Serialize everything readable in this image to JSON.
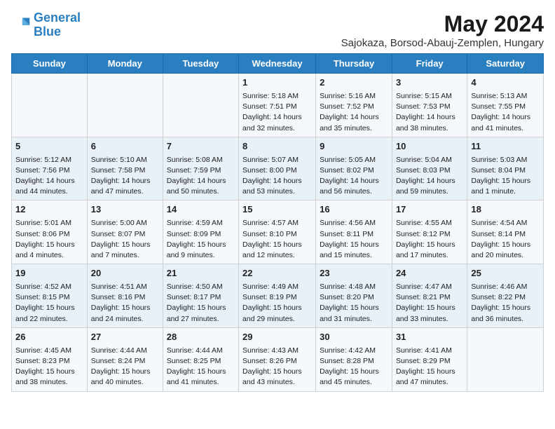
{
  "logo": {
    "line1": "General",
    "line2": "Blue"
  },
  "title": "May 2024",
  "subtitle": "Sajokaza, Borsod-Abauj-Zemplen, Hungary",
  "days_of_week": [
    "Sunday",
    "Monday",
    "Tuesday",
    "Wednesday",
    "Thursday",
    "Friday",
    "Saturday"
  ],
  "weeks": [
    [
      {
        "day": "",
        "info": ""
      },
      {
        "day": "",
        "info": ""
      },
      {
        "day": "",
        "info": ""
      },
      {
        "day": "1",
        "info": "Sunrise: 5:18 AM\nSunset: 7:51 PM\nDaylight: 14 hours and 32 minutes."
      },
      {
        "day": "2",
        "info": "Sunrise: 5:16 AM\nSunset: 7:52 PM\nDaylight: 14 hours and 35 minutes."
      },
      {
        "day": "3",
        "info": "Sunrise: 5:15 AM\nSunset: 7:53 PM\nDaylight: 14 hours and 38 minutes."
      },
      {
        "day": "4",
        "info": "Sunrise: 5:13 AM\nSunset: 7:55 PM\nDaylight: 14 hours and 41 minutes."
      }
    ],
    [
      {
        "day": "5",
        "info": "Sunrise: 5:12 AM\nSunset: 7:56 PM\nDaylight: 14 hours and 44 minutes."
      },
      {
        "day": "6",
        "info": "Sunrise: 5:10 AM\nSunset: 7:58 PM\nDaylight: 14 hours and 47 minutes."
      },
      {
        "day": "7",
        "info": "Sunrise: 5:08 AM\nSunset: 7:59 PM\nDaylight: 14 hours and 50 minutes."
      },
      {
        "day": "8",
        "info": "Sunrise: 5:07 AM\nSunset: 8:00 PM\nDaylight: 14 hours and 53 minutes."
      },
      {
        "day": "9",
        "info": "Sunrise: 5:05 AM\nSunset: 8:02 PM\nDaylight: 14 hours and 56 minutes."
      },
      {
        "day": "10",
        "info": "Sunrise: 5:04 AM\nSunset: 8:03 PM\nDaylight: 14 hours and 59 minutes."
      },
      {
        "day": "11",
        "info": "Sunrise: 5:03 AM\nSunset: 8:04 PM\nDaylight: 15 hours and 1 minute."
      }
    ],
    [
      {
        "day": "12",
        "info": "Sunrise: 5:01 AM\nSunset: 8:06 PM\nDaylight: 15 hours and 4 minutes."
      },
      {
        "day": "13",
        "info": "Sunrise: 5:00 AM\nSunset: 8:07 PM\nDaylight: 15 hours and 7 minutes."
      },
      {
        "day": "14",
        "info": "Sunrise: 4:59 AM\nSunset: 8:09 PM\nDaylight: 15 hours and 9 minutes."
      },
      {
        "day": "15",
        "info": "Sunrise: 4:57 AM\nSunset: 8:10 PM\nDaylight: 15 hours and 12 minutes."
      },
      {
        "day": "16",
        "info": "Sunrise: 4:56 AM\nSunset: 8:11 PM\nDaylight: 15 hours and 15 minutes."
      },
      {
        "day": "17",
        "info": "Sunrise: 4:55 AM\nSunset: 8:12 PM\nDaylight: 15 hours and 17 minutes."
      },
      {
        "day": "18",
        "info": "Sunrise: 4:54 AM\nSunset: 8:14 PM\nDaylight: 15 hours and 20 minutes."
      }
    ],
    [
      {
        "day": "19",
        "info": "Sunrise: 4:52 AM\nSunset: 8:15 PM\nDaylight: 15 hours and 22 minutes."
      },
      {
        "day": "20",
        "info": "Sunrise: 4:51 AM\nSunset: 8:16 PM\nDaylight: 15 hours and 24 minutes."
      },
      {
        "day": "21",
        "info": "Sunrise: 4:50 AM\nSunset: 8:17 PM\nDaylight: 15 hours and 27 minutes."
      },
      {
        "day": "22",
        "info": "Sunrise: 4:49 AM\nSunset: 8:19 PM\nDaylight: 15 hours and 29 minutes."
      },
      {
        "day": "23",
        "info": "Sunrise: 4:48 AM\nSunset: 8:20 PM\nDaylight: 15 hours and 31 minutes."
      },
      {
        "day": "24",
        "info": "Sunrise: 4:47 AM\nSunset: 8:21 PM\nDaylight: 15 hours and 33 minutes."
      },
      {
        "day": "25",
        "info": "Sunrise: 4:46 AM\nSunset: 8:22 PM\nDaylight: 15 hours and 36 minutes."
      }
    ],
    [
      {
        "day": "26",
        "info": "Sunrise: 4:45 AM\nSunset: 8:23 PM\nDaylight: 15 hours and 38 minutes."
      },
      {
        "day": "27",
        "info": "Sunrise: 4:44 AM\nSunset: 8:24 PM\nDaylight: 15 hours and 40 minutes."
      },
      {
        "day": "28",
        "info": "Sunrise: 4:44 AM\nSunset: 8:25 PM\nDaylight: 15 hours and 41 minutes."
      },
      {
        "day": "29",
        "info": "Sunrise: 4:43 AM\nSunset: 8:26 PM\nDaylight: 15 hours and 43 minutes."
      },
      {
        "day": "30",
        "info": "Sunrise: 4:42 AM\nSunset: 8:28 PM\nDaylight: 15 hours and 45 minutes."
      },
      {
        "day": "31",
        "info": "Sunrise: 4:41 AM\nSunset: 8:29 PM\nDaylight: 15 hours and 47 minutes."
      },
      {
        "day": "",
        "info": ""
      }
    ]
  ]
}
